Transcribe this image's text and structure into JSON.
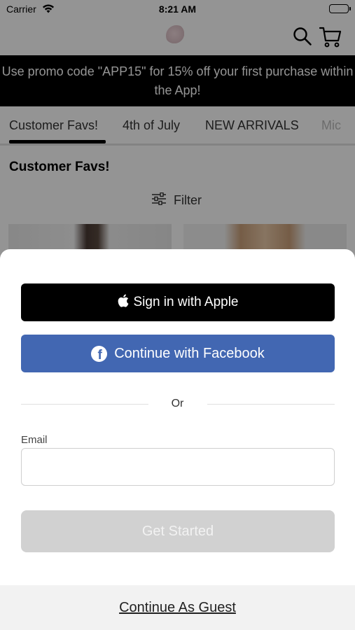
{
  "status_bar": {
    "carrier": "Carrier",
    "time": "8:21 AM",
    "battery_level": 1.0
  },
  "header": {
    "logo_icon": "brand-logo-icon",
    "search_icon": "search-icon",
    "cart_icon": "cart-icon"
  },
  "promo": {
    "text": "Use promo code \"APP15\" for 15% off your first purchase within the App!"
  },
  "tabs": [
    {
      "label": "Customer Favs!",
      "selected": true
    },
    {
      "label": "4th of July",
      "selected": false
    },
    {
      "label": "NEW ARRIVALS",
      "selected": false
    },
    {
      "label": "Mic",
      "selected": false
    }
  ],
  "section": {
    "title": "Customer Favs!",
    "filter_label": "Filter",
    "filter_icon": "sliders-icon"
  },
  "sheet": {
    "apple_label": "Sign in with Apple",
    "facebook_label": "Continue with Facebook",
    "or_label": "Or",
    "email_label": "Email",
    "email_value": "",
    "email_placeholder": "",
    "get_started_label": "Get Started",
    "guest_label": "Continue As Guest"
  },
  "colors": {
    "promo_background": "#000000",
    "facebook_blue": "#4267b2",
    "apple_black": "#000000",
    "disabled_button": "#d1d1d1"
  }
}
